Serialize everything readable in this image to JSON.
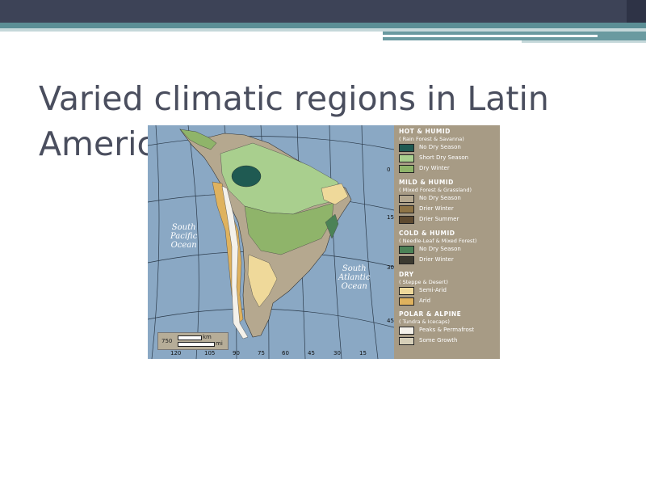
{
  "slide": {
    "title": "Varied climatic regions in Latin America"
  },
  "map": {
    "ocean_labels": {
      "pacific": [
        "South",
        "Pacific",
        "Ocean"
      ],
      "atlantic": [
        "South",
        "Atlantic",
        "Ocean"
      ]
    },
    "scale": {
      "value": "750",
      "unit_km": "km",
      "unit_mi": "mi"
    },
    "longitude_labels": [
      "120",
      "105",
      "90",
      "75",
      "60",
      "45",
      "30",
      "15"
    ],
    "latitude_labels": [
      "0",
      "15",
      "30",
      "45"
    ],
    "legend": {
      "groups": [
        {
          "heading": "HOT & HUMID",
          "sub": "( Rain Forest & Savanna)",
          "items": [
            {
              "label": "No Dry Season",
              "color": "#1f5a52"
            },
            {
              "label": "Short Dry Season",
              "color": "#a9cf8e"
            },
            {
              "label": "Dry Winter",
              "color": "#8fb46a"
            }
          ]
        },
        {
          "heading": "MILD & HUMID",
          "sub": "( Mixed Forest & Grassland)",
          "items": [
            {
              "label": "No Dry Season",
              "color": "#b5a88f"
            },
            {
              "label": "Drier Winter",
              "color": "#8e7446"
            },
            {
              "label": "Drier Summer",
              "color": "#5e4a30"
            }
          ]
        },
        {
          "heading": "COLD & HUMID",
          "sub": "( Needle-Leaf & Mixed Forest)",
          "items": [
            {
              "label": "No Dry Season",
              "color": "#4b8256"
            },
            {
              "label": "Drier Winter",
              "color": "#3c3a30"
            }
          ]
        },
        {
          "heading": "DRY",
          "sub": "( Steppe & Desert)",
          "items": [
            {
              "label": "Semi-Arid",
              "color": "#efd99a"
            },
            {
              "label": "Arid",
              "color": "#dfb25e"
            }
          ]
        },
        {
          "heading": "POLAR & ALPINE",
          "sub": "( Tundra & Icecaps)",
          "items": [
            {
              "label": "Peaks & Permafrost",
              "color": "#f4f1ea"
            },
            {
              "label": "Some Growth",
              "color": "#d6cfb8"
            }
          ]
        }
      ]
    }
  }
}
